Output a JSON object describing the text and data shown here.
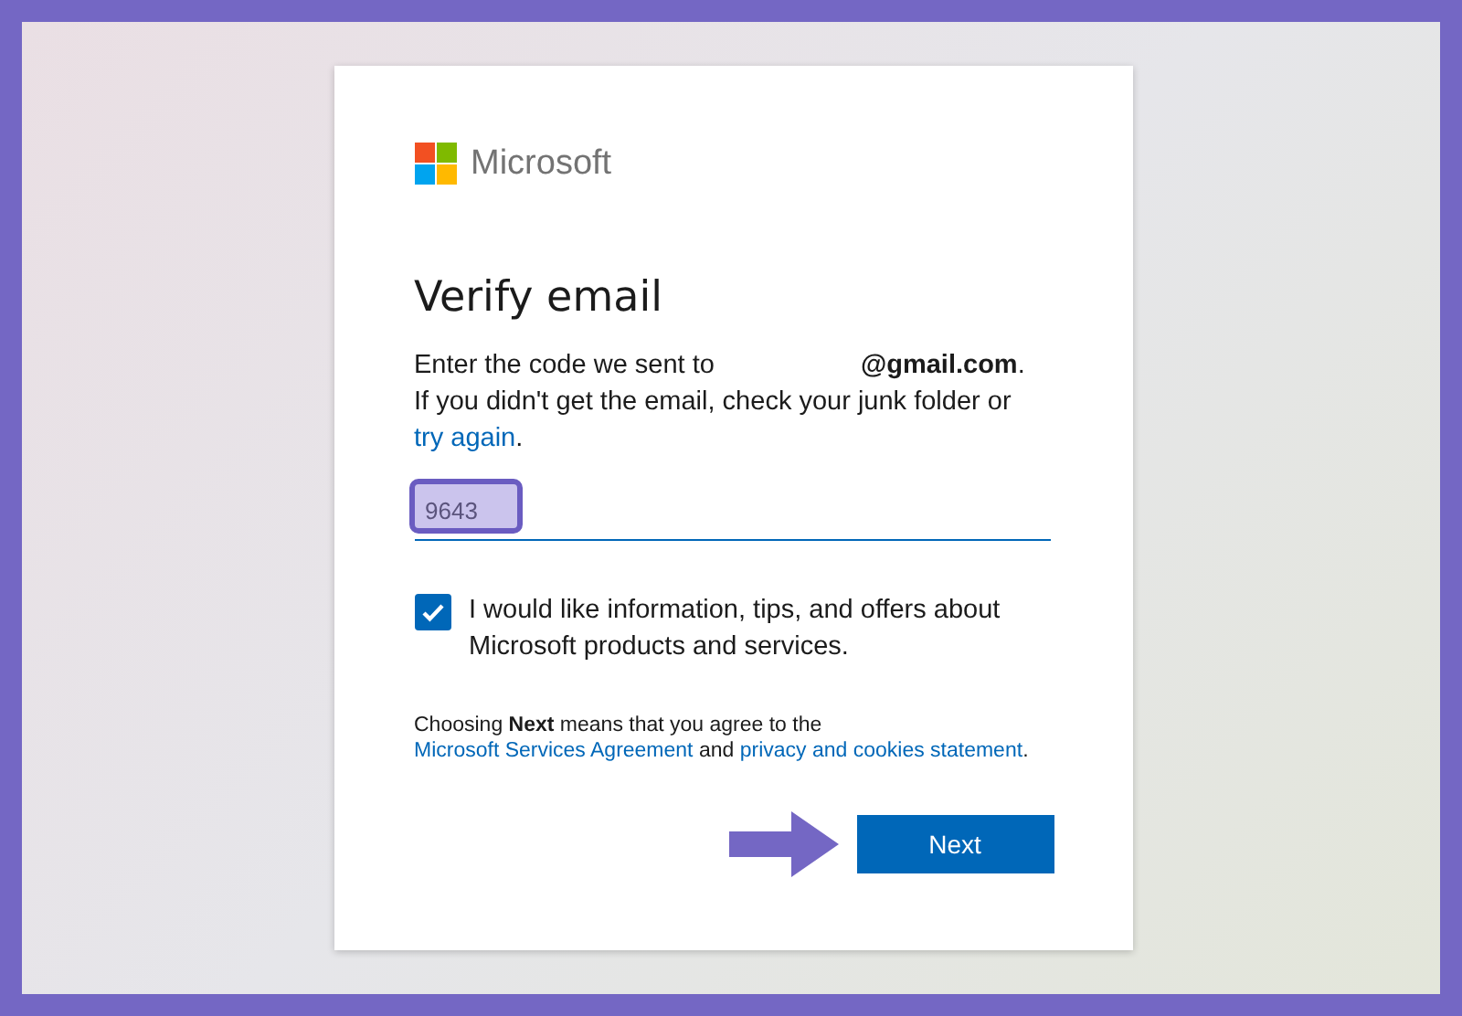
{
  "brand": {
    "name": "Microsoft"
  },
  "heading": "Verify email",
  "message": {
    "intro": "Enter the code we sent to",
    "email": "@gmail.com",
    "period": ".",
    "line2": "If you didn't get the email, check your junk folder or",
    "link": "try again",
    "end": "."
  },
  "code_field": {
    "value": "9643",
    "highlighted": true
  },
  "consent": {
    "label": "I would like information, tips, and offers about Microsoft products and services.",
    "checked": true
  },
  "terms": {
    "text": "Choosing **Next** means that you agree to the",
    "link1": "Microsoft Services Agreement",
    "middle": "and",
    "link2": "privacy and cookies statement",
    "end": "."
  },
  "next_button": {
    "label": "Next",
    "pointer_arrow": true
  }
}
